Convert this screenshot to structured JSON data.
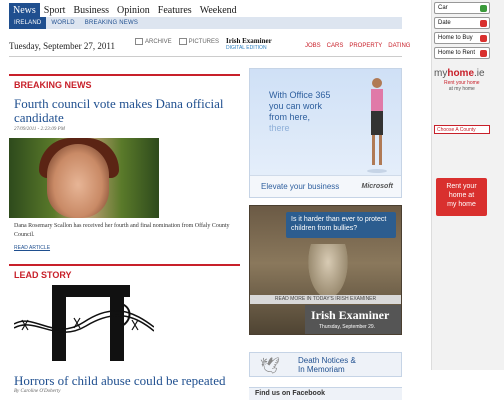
{
  "nav": {
    "tabs": [
      "News",
      "Sport",
      "Business",
      "Opinion",
      "Features",
      "Weekend"
    ],
    "subtabs": [
      "IRELAND",
      "WORLD",
      "BREAKING NEWS"
    ]
  },
  "header": {
    "date": "Tuesday, September 27, 2011",
    "archive_label": "ARCHIVE",
    "pictures_label": "PICTURES",
    "logo_title": "Irish Examiner",
    "logo_sub": "DIGITAL EDITION",
    "links": [
      "JOBS",
      "CARS",
      "PROPERTY",
      "DATING"
    ]
  },
  "breaking": {
    "label": "BREAKING NEWS",
    "headline": "Fourth council vote makes Dana official candidate",
    "timestamp": "27/09/2011 - 2:23:09 PM",
    "caption": "Dana Rosemary Scallon has received her fourth and final nomination from Offaly County Council.",
    "read_more": "READ ARTICLE"
  },
  "lead": {
    "label": "LEAD STORY",
    "headline": "Horrors of child abuse could be repeated",
    "byline": "By Caroline O'Doherty"
  },
  "ad_office": {
    "line1": "With Office 365",
    "line2": "you can work",
    "line3": "from here,",
    "line4": "there",
    "slogan": "Elevate your business",
    "brand": "Microsoft"
  },
  "ad_examiner": {
    "bubble": "Is it harder than ever to protect children from bullies?",
    "bar_text": "READ MORE IN TODAY'S IRISH EXAMINER",
    "logo": "Irish Examiner",
    "date": "Thursday, September 29."
  },
  "notices": {
    "line1": "Death Notices &",
    "line2": "In Memoriam"
  },
  "facebook": {
    "label": "Find us on Facebook"
  },
  "sidebar": {
    "buttons": [
      "Car",
      "Date",
      "Home to Buy",
      "Home to Rent"
    ],
    "logo_my": "my",
    "logo_home": "home",
    "logo_ie": ".ie",
    "tag_red": "Rent your home",
    "tag": "at my home",
    "county": "Choose A County",
    "rent_line1": "Rent your",
    "rent_line2": "home at",
    "rent_line3": "my home"
  },
  "colors": {
    "nav_blue": "#1f4f8f",
    "accent_red": "#c8202a",
    "subnav_bg": "#dde5f0"
  }
}
